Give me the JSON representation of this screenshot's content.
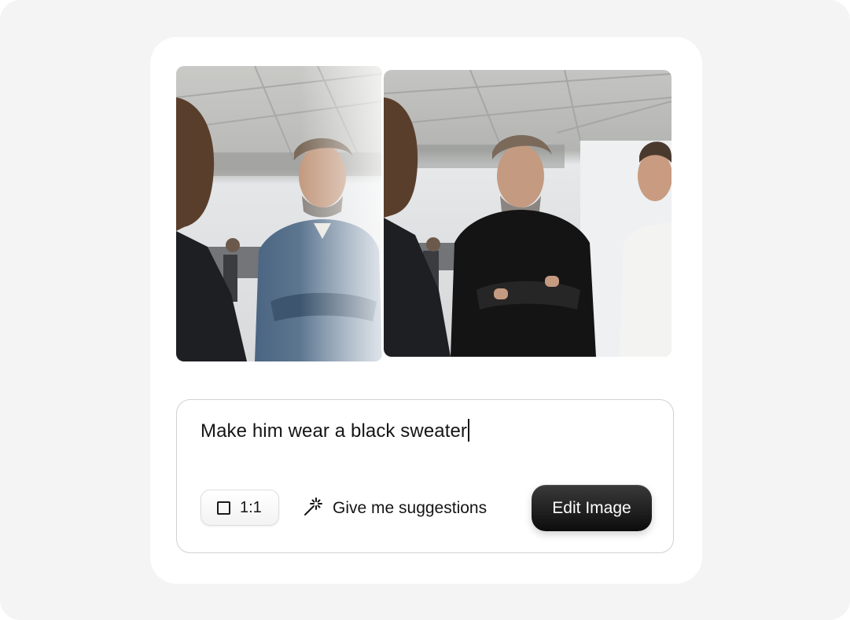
{
  "prompt": {
    "text": "Make him wear a black sweater"
  },
  "toolbar": {
    "aspect_ratio_label": "1:1",
    "aspect_ratio_icon": "square-icon",
    "suggestions_label": "Give me suggestions",
    "suggestions_icon": "magic-wand-icon",
    "submit_label": "Edit Image"
  },
  "images": {
    "before_subject_shirt_color": "#4a6582",
    "after_subject_sweater_color": "#141414"
  },
  "colors": {
    "page_background": "#f4f4f4",
    "card_background": "#ffffff",
    "primary_button": "#111111"
  }
}
